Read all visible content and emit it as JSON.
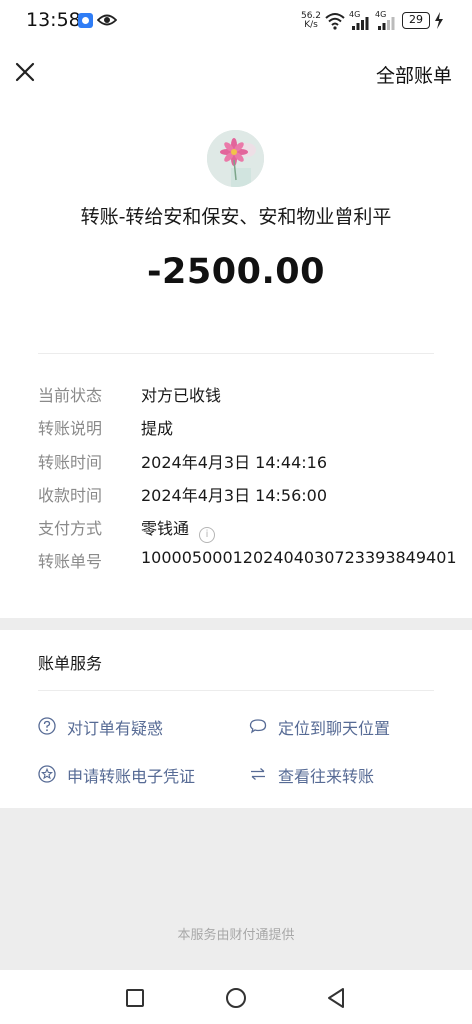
{
  "status_bar": {
    "time": "13:58",
    "net_speed_value": "56.2",
    "net_speed_unit": "K/s",
    "signal1_label": "4G",
    "signal2_label": "4G",
    "battery": "29"
  },
  "header": {
    "right_label": "全部账单"
  },
  "transfer": {
    "payee": "转账-转给安和保安、安和物业曾利平",
    "amount": "-2500.00"
  },
  "details": [
    {
      "label": "当前状态",
      "value": "对方已收钱"
    },
    {
      "label": "转账说明",
      "value": "提成"
    },
    {
      "label": "转账时间",
      "value": "2024年4月3日 14:44:16"
    },
    {
      "label": "收款时间",
      "value": "2024年4月3日 14:56:00"
    },
    {
      "label": "支付方式",
      "value": "零钱通"
    },
    {
      "label": "转账单号",
      "value": "1000050001202404030723393849401"
    }
  ],
  "services": {
    "title": "账单服务",
    "links": [
      {
        "label": "对订单有疑惑",
        "icon": "question-icon"
      },
      {
        "label": "定位到聊天位置",
        "icon": "chat-bubble-icon"
      },
      {
        "label": "申请转账电子凭证",
        "icon": "star-badge-icon"
      },
      {
        "label": "查看往来转账",
        "icon": "swap-arrows-icon"
      }
    ]
  },
  "footer": "本服务由财付通提供",
  "colors": {
    "link": "#576b95",
    "label_gray": "#8a8a8a",
    "background": "#ededed"
  }
}
